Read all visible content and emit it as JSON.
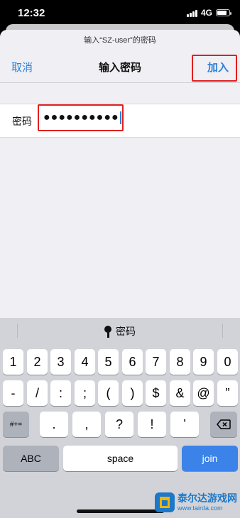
{
  "status_bar": {
    "time": "12:32",
    "network": "4G"
  },
  "sheet": {
    "prompt": "输入“SZ-user”的密码",
    "nav": {
      "cancel": "取消",
      "title": "输入密码",
      "join": "加入"
    },
    "password": {
      "label": "密码",
      "value": "●●●●●●●●●●"
    }
  },
  "keyboard": {
    "suggestion": "密码",
    "row1": [
      "1",
      "2",
      "3",
      "4",
      "5",
      "6",
      "7",
      "8",
      "9",
      "0"
    ],
    "row2": [
      "-",
      "/",
      ":",
      ";",
      "(",
      ")",
      "$",
      "&",
      "@",
      "”"
    ],
    "row3": [
      "#+=",
      ".",
      ",",
      "?",
      "!",
      "’"
    ],
    "row4": {
      "abc": "ABC",
      "space": "space",
      "join": "join"
    }
  },
  "watermark": {
    "name": "泰尔达游戏网",
    "url": "www.tairda.com"
  },
  "colors": {
    "accent": "#2f7fd8",
    "highlight": "#e02020",
    "join_key": "#3b83e8"
  }
}
